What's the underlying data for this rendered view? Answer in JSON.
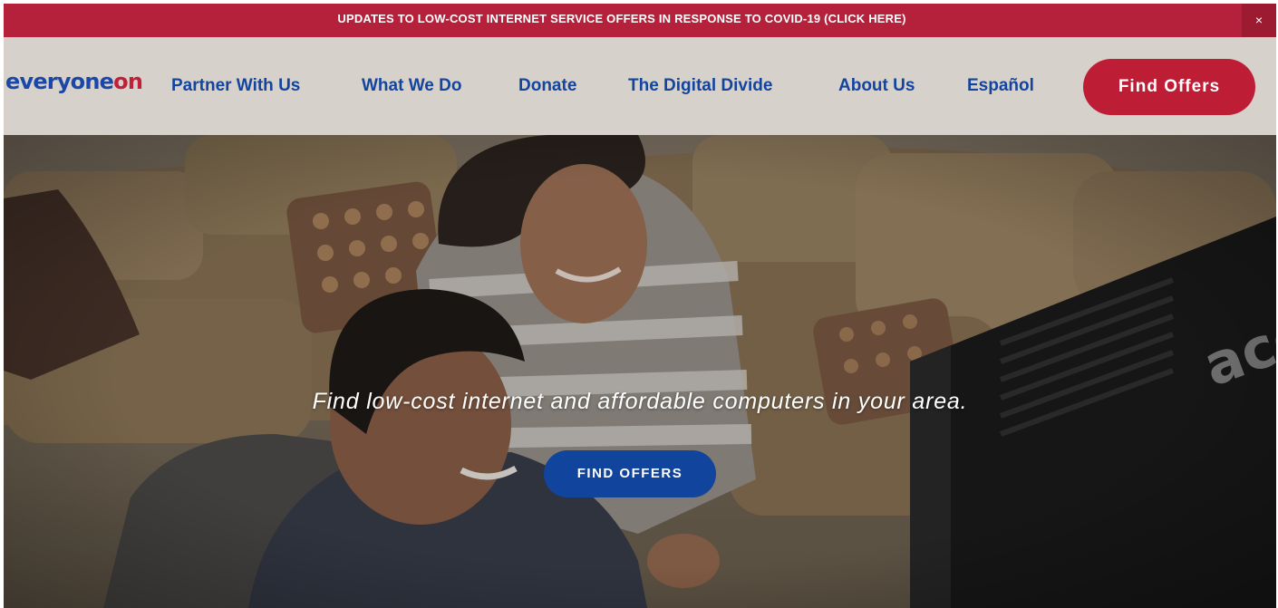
{
  "banner": {
    "text": "UPDATES TO LOW-COST INTERNET SERVICE OFFERS IN RESPONSE TO COVID-19 (CLICK HERE)",
    "close_glyph": "×"
  },
  "header": {
    "logo": {
      "part1": "everyone",
      "part2": "on"
    },
    "nav": [
      {
        "label": "Partner With Us"
      },
      {
        "label": "What We Do"
      },
      {
        "label": "Donate"
      },
      {
        "label": "The Digital Divide"
      },
      {
        "label": "About Us"
      },
      {
        "label": "Español"
      }
    ],
    "cta_label": "Find Offers"
  },
  "hero": {
    "tagline": "Find low-cost internet and affordable computers in your area.",
    "button_label": "FIND OFFERS",
    "monitor_brand": "acer"
  },
  "colors": {
    "banner_bg": "#b5213a",
    "header_bg": "#d6d1ca",
    "nav_text": "#13449e",
    "cta_bg": "#bd1e35",
    "hero_button_bg": "#11449d"
  }
}
